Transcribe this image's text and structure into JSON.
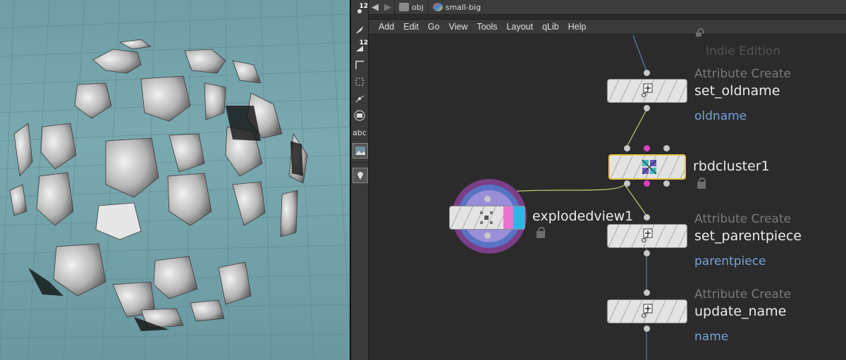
{
  "network": {
    "path": [
      {
        "label": "obj",
        "icon": "obj-icon"
      },
      {
        "label": "small-big",
        "icon": "geo-icon"
      }
    ],
    "menu": [
      "Add",
      "Edit",
      "Go",
      "View",
      "Tools",
      "Layout",
      "qLib",
      "Help"
    ],
    "edition": "Indie Edition",
    "nodes": {
      "set_oldname": {
        "type": "Attribute Create",
        "name": "set_oldname",
        "attr": "oldname"
      },
      "rbdcluster1": {
        "name": "rbdcluster1"
      },
      "explodedview1": {
        "name": "explodedview1"
      },
      "set_parentpiece": {
        "type": "Attribute Create",
        "name": "set_parentpiece",
        "attr": "parentpiece"
      },
      "update_name": {
        "type": "Attribute Create",
        "name": "update_name",
        "attr": "name"
      }
    }
  },
  "shelf": {
    "items": [
      {
        "name": "points-display",
        "sub": "12"
      },
      {
        "name": "brush-tool"
      },
      {
        "name": "primitives-display",
        "sub": "12"
      },
      {
        "name": "edge-tool"
      },
      {
        "name": "snap-grid"
      },
      {
        "name": "handle-tool"
      },
      {
        "name": "display-toggle"
      },
      {
        "name": "label-display",
        "label": "abc"
      },
      {
        "name": "background-image"
      },
      {
        "name": "pin-viewport"
      }
    ]
  },
  "colors": {
    "viewport_bg": "#7ba9b0",
    "network_bg": "#2b2b2b",
    "wire_selected": "#c8c870",
    "wire_default": "#8a8a8a",
    "attr_text": "#74a3dc",
    "node_highlight": "#e6c34a",
    "explode_outer": "#7a3f86",
    "explode_inner": "#5872c4"
  }
}
